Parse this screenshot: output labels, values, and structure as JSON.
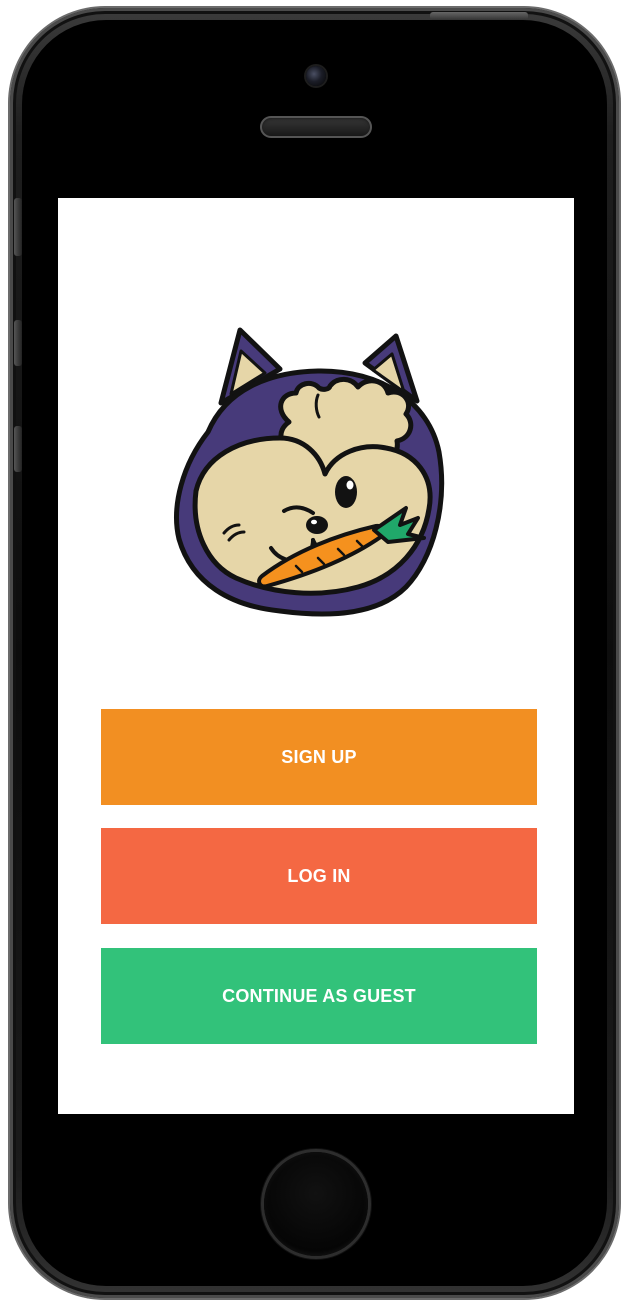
{
  "theme": {
    "signup_color": "#F28F22",
    "login_color": "#F46843",
    "guest_color": "#32C27A",
    "mascot_outline": "#121212",
    "mascot_fur": "#473A7A",
    "mascot_face": "#E6D6A8",
    "carrot_color": "#F5911E",
    "carrot_leaf_color": "#20A86A"
  },
  "device": {
    "type": "smartphone",
    "icons": {
      "camera": "camera-icon",
      "speaker": "speaker-icon",
      "home": "home-button-icon"
    }
  },
  "mascot": {
    "icon_name": "fox-with-carrot-icon",
    "description_visible": false
  },
  "buttons": [
    {
      "label": "SIGN UP"
    },
    {
      "label": "LOG IN"
    },
    {
      "label": "CONTINUE AS GUEST"
    }
  ]
}
